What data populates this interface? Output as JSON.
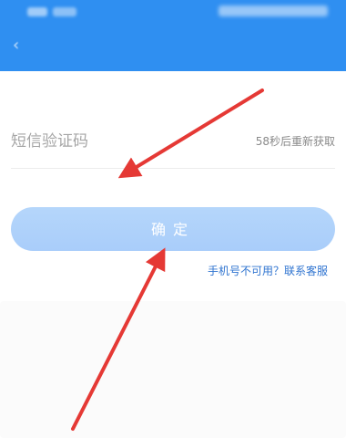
{
  "header": {
    "title": "",
    "back_icon": "chevron-left-icon",
    "background_color": "#2f8ff1"
  },
  "phone": {
    "label": "",
    "value": ""
  },
  "sms": {
    "placeholder": "短信验证码",
    "resend_text": "58秒后重新获取"
  },
  "confirm": {
    "label": "确定",
    "color": "#aacdfa"
  },
  "help": {
    "label": "手机号不可用？联系客服",
    "color": "#2f74d0"
  },
  "annotation": {
    "arrow_color": "#e53935"
  }
}
